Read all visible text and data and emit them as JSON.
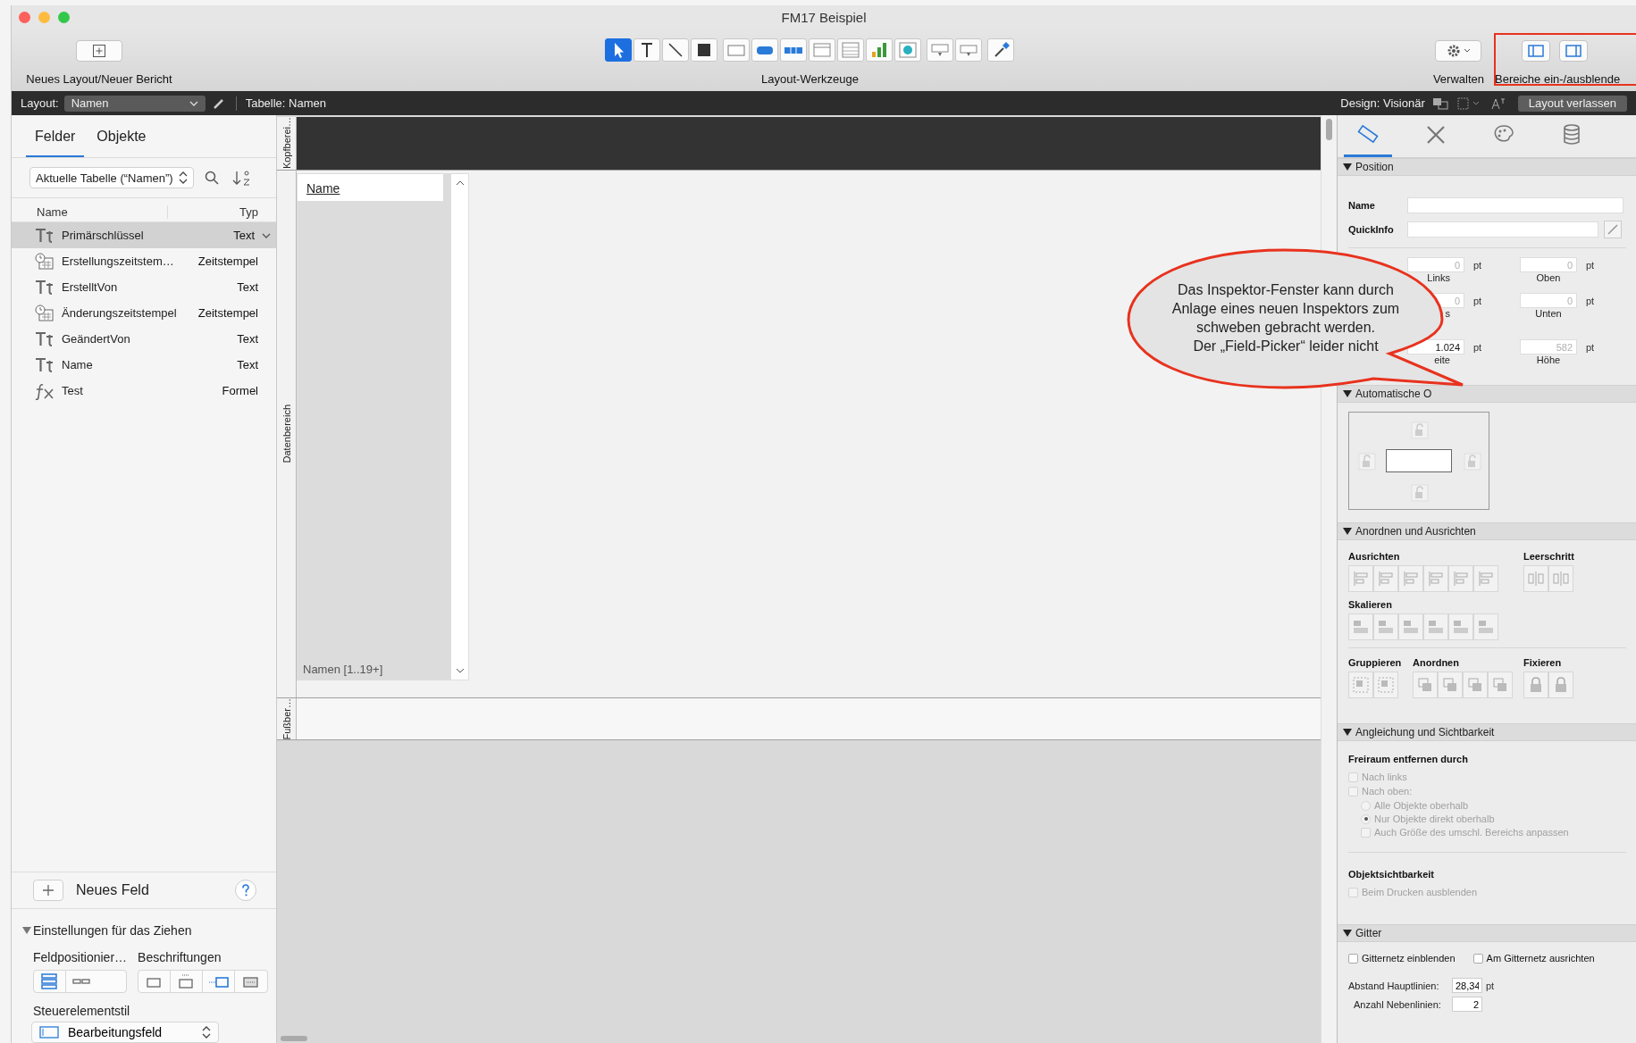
{
  "window": {
    "title": "FM17 Beispiel"
  },
  "toolbar": {
    "new_layout": "Neues Layout/Neuer Bericht",
    "tool_groups": [
      [
        {
          "kind": "pointer",
          "selected": true
        },
        {
          "kind": "text",
          "selected": false
        },
        {
          "kind": "line",
          "selected": false
        },
        {
          "kind": "shape",
          "selected": false
        }
      ],
      [
        {
          "kind": "field",
          "selected": false
        },
        {
          "kind": "button",
          "selected": false
        },
        {
          "kind": "button_bar",
          "selected": false
        },
        {
          "kind": "popover",
          "selected": false
        },
        {
          "kind": "portal",
          "selected": false
        },
        {
          "kind": "chart",
          "selected": false
        },
        {
          "kind": "web_viewer",
          "selected": false
        }
      ],
      [
        {
          "kind": "slide_control",
          "selected": false
        },
        {
          "kind": "tab_control",
          "selected": false
        }
      ],
      [
        {
          "kind": "format_painter",
          "selected": false
        }
      ]
    ],
    "tools_label": "Layout-Werkzeuge",
    "manage": "Verwalten",
    "panes": "Bereiche ein-/ausblende",
    "panes_highlighted": true
  },
  "layout_bar": {
    "layout_label": "Layout:",
    "layout": "Namen",
    "table": "Tabelle: Namen",
    "theme": "Design: Visionär",
    "exit": "Layout verlassen"
  },
  "field_picker": {
    "tabs": [
      {
        "label": "Felder",
        "selected": true
      },
      {
        "label": "Objekte",
        "selected": false
      }
    ],
    "table_select": "Aktuelle Tabelle (“Namen”)",
    "columns": [
      "Name",
      "Typ"
    ],
    "fields": [
      {
        "kind": "text",
        "name": "Primärschlüssel",
        "type": "Text",
        "selected": true
      },
      {
        "kind": "timestamp",
        "name": "Erstellungszeitstem…",
        "type": "Zeitstempel",
        "selected": false
      },
      {
        "kind": "text",
        "name": "ErstelltVon",
        "type": "Text",
        "selected": false
      },
      {
        "kind": "timestamp",
        "name": "Änderungszeitstempel",
        "type": "Zeitstempel",
        "selected": false
      },
      {
        "kind": "text",
        "name": "GeändertVon",
        "type": "Text",
        "selected": false
      },
      {
        "kind": "text",
        "name": "Name",
        "type": "Text",
        "selected": false
      },
      {
        "kind": "calculation",
        "name": "Test",
        "type": "Formel",
        "selected": false
      }
    ],
    "new_field": "Neues Feld",
    "drag_settings": {
      "title": "Einstellungen für das Ziehen",
      "expanded": true,
      "positioning_label": "Feldpositionier…",
      "positioning": [
        {
          "kind": "vertical",
          "selected": true
        },
        {
          "kind": "horizontal",
          "selected": false
        }
      ],
      "labels_label": "Beschriftungen",
      "labels": [
        {
          "kind": "none",
          "selected": false
        },
        {
          "kind": "top",
          "selected": false
        },
        {
          "kind": "left",
          "selected": true
        },
        {
          "kind": "inside",
          "selected": false
        }
      ],
      "style_label": "Steuerelementstil",
      "style": "Bearbeitungsfeld"
    }
  },
  "canvas": {
    "parts": [
      {
        "kind": "header",
        "label": "Kopfberei…"
      },
      {
        "kind": "body",
        "label": "Datenbereich"
      },
      {
        "kind": "footer",
        "label": "Fußber…"
      }
    ],
    "portal": {
      "field": "Name",
      "footer": "Namen [1..19+]"
    }
  },
  "inspector": {
    "tabs": [
      {
        "kind": "position",
        "selected": true
      },
      {
        "kind": "style",
        "selected": false
      },
      {
        "kind": "appearance",
        "selected": false
      },
      {
        "kind": "data",
        "selected": false
      }
    ],
    "position": {
      "title": "Position",
      "expanded": true,
      "name_label": "Name",
      "quickinfo_label": "QuickInfo",
      "coords": [
        {
          "value": "0",
          "disabled": true,
          "unit": "pt",
          "label": "Links"
        },
        {
          "value": "0",
          "disabled": true,
          "unit": "pt",
          "label": "Oben"
        },
        {
          "value": "0",
          "disabled": true,
          "unit": "pt",
          "label": "s"
        },
        {
          "value": "0",
          "disabled": true,
          "unit": "pt",
          "label": "Unten"
        },
        {
          "value": "1.024",
          "disabled": false,
          "unit": "pt",
          "label": "eite"
        },
        {
          "value": "582",
          "disabled": true,
          "unit": "pt",
          "label": "Höhe"
        }
      ]
    },
    "anchoring": {
      "title": "Automatische O",
      "expanded": true
    },
    "arrange": {
      "title": "Anordnen und Ausrichten",
      "expanded": true,
      "disabled": true,
      "groups": [
        {
          "kind": "align",
          "label": "Ausrichten"
        },
        {
          "kind": "space",
          "label": "Leerschritt"
        },
        {
          "kind": "resize",
          "label": "Skalieren"
        },
        {
          "kind": "group",
          "label": "Gruppieren"
        },
        {
          "kind": "order",
          "label": "Anordnen"
        },
        {
          "kind": "lock",
          "label": "Fixieren"
        }
      ]
    },
    "sliding": {
      "title": "Angleichung und Sichtbarkeit",
      "expanded": true,
      "remove_space_label": "Freiraum entfernen durch",
      "options": [
        {
          "label": "Nach links",
          "checked": false,
          "disabled": true
        },
        {
          "label": "Nach oben:",
          "checked": false,
          "disabled": true,
          "children": [
            {
              "kind": "radio",
              "label": "Alle Objekte oberhalb",
              "selected": false,
              "disabled": true
            },
            {
              "kind": "radio",
              "label": "Nur Objekte direkt oberhalb",
              "selected": true,
              "disabled": true
            },
            {
              "kind": "checkbox",
              "label": "Auch Größe des umschl. Bereichs anpassen",
              "checked": false,
              "disabled": true
            }
          ]
        }
      ],
      "visibility_label": "Objektsichtbarkeit",
      "visibility": [
        {
          "label": "Beim Drucken ausblenden",
          "checked": false,
          "disabled": true
        }
      ]
    },
    "grid": {
      "title": "Gitter",
      "expanded": true,
      "options": [
        {
          "label": "Gitternetz einblenden",
          "checked": false
        },
        {
          "label": "Am Gitternetz ausrichten",
          "checked": false
        }
      ],
      "major_label": "Abstand Hauptlinien:",
      "major": "28,34",
      "major_unit": "pt",
      "minor_label": "Anzahl Nebenlinien:",
      "minor": "2"
    }
  },
  "callout": {
    "lines": [
      "Das Inspektor-Fenster kann durch",
      "Anlage eines neuen Inspektors zum",
      "schweben gebracht werden.",
      "Der „Field-Picker“ leider nicht"
    ]
  }
}
